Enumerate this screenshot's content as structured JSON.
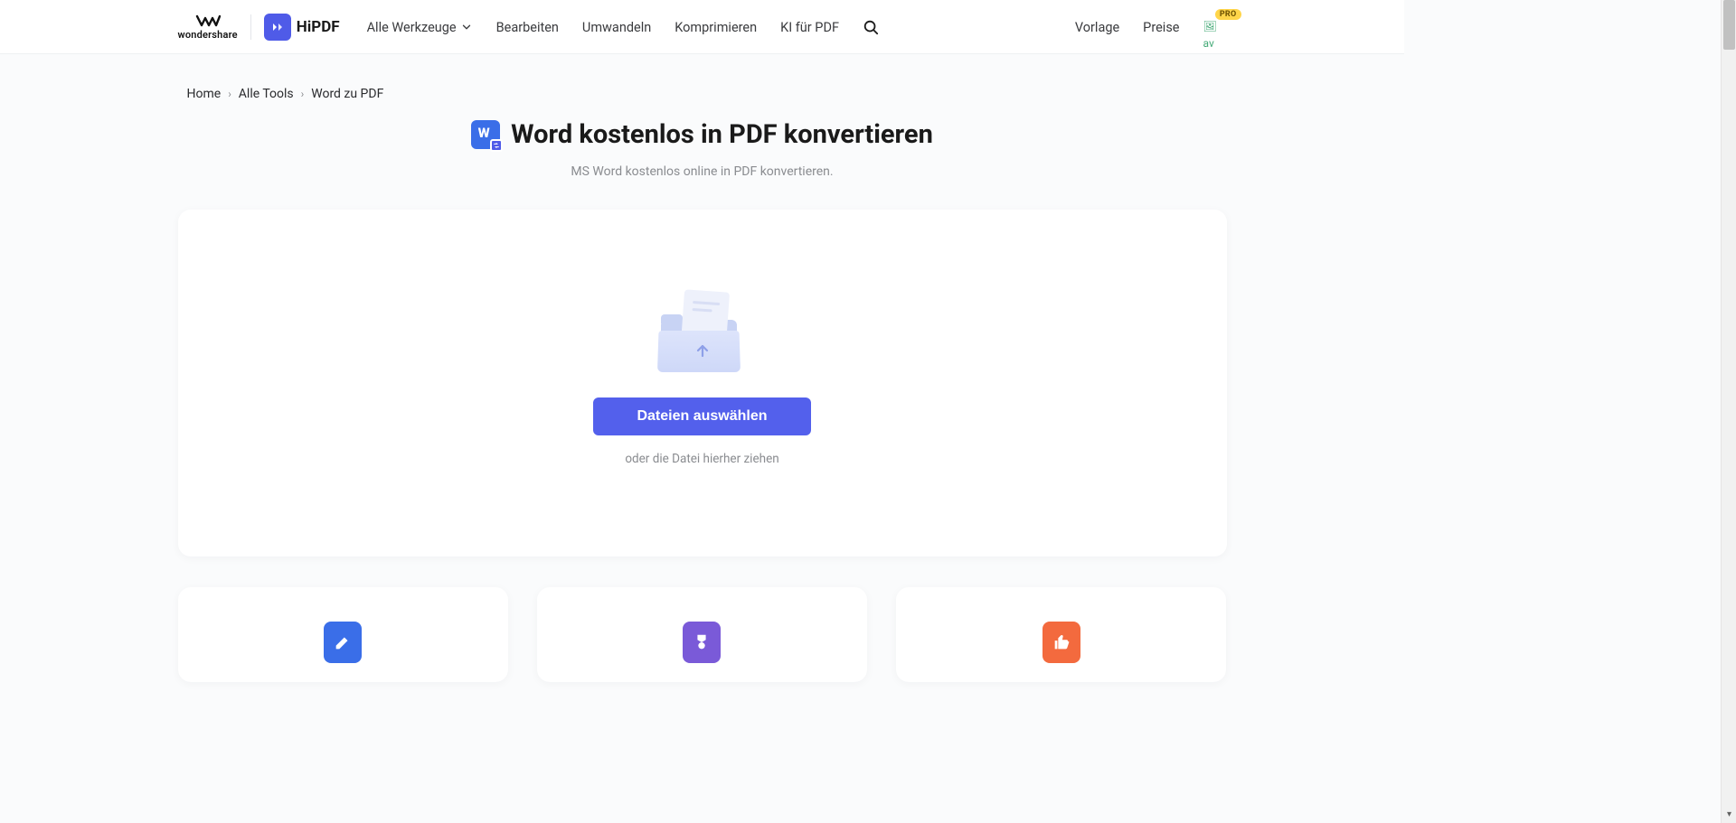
{
  "header": {
    "wondershare_label": "wondershare",
    "hipdf_label": "HiPDF",
    "nav": {
      "all_tools": "Alle Werkzeuge",
      "edit": "Bearbeiten",
      "convert": "Umwandeln",
      "compress": "Komprimieren",
      "ai_pdf": "KI für PDF"
    },
    "right": {
      "template": "Vorlage",
      "pricing": "Preise",
      "avatar_alt": "av",
      "pro_badge": "PRO"
    }
  },
  "breadcrumb": {
    "home": "Home",
    "all_tools": "Alle Tools",
    "current": "Word zu PDF"
  },
  "hero": {
    "title": "Word kostenlos in PDF konvertieren",
    "subtitle": "MS Word kostenlos online in PDF konvertieren."
  },
  "upload": {
    "choose_files": "Dateien auswählen",
    "drag_hint": "oder die Datei hierher ziehen"
  }
}
